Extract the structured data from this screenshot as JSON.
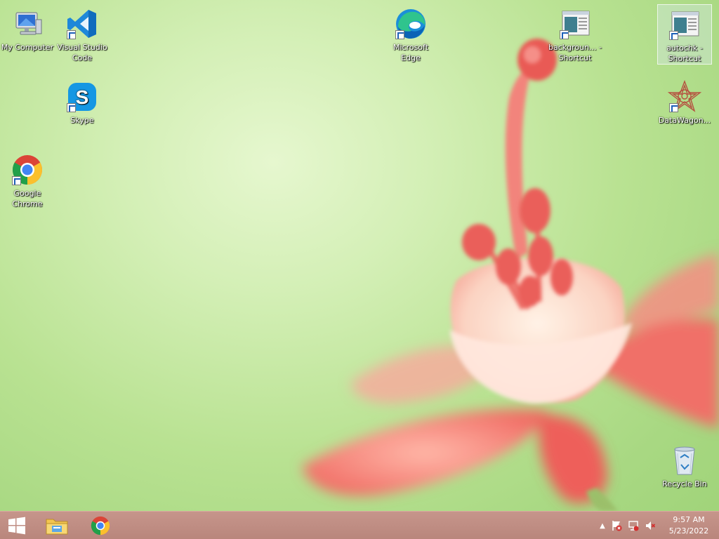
{
  "desktop": {
    "icons": [
      {
        "label": "My Computer",
        "icon": "computer-icon"
      },
      {
        "label": "Visual Studio Code",
        "icon": "vscode-icon"
      },
      {
        "label": "Skype",
        "icon": "skype-icon"
      },
      {
        "label": "Google Chrome",
        "icon": "chrome-icon"
      },
      {
        "label": "Microsoft Edge",
        "icon": "edge-icon"
      },
      {
        "label": "backgroun... - Shortcut",
        "icon": "window-shortcut-icon"
      },
      {
        "label": "autochk - Shortcut",
        "icon": "window-shortcut-icon"
      },
      {
        "label": "DataWagon...",
        "icon": "datawagon-icon"
      },
      {
        "label": "Recycle Bin",
        "icon": "recycle-bin-icon"
      }
    ]
  },
  "taskbar": {
    "start_icon": "windows-logo-icon",
    "pinned": [
      {
        "icon": "file-explorer-icon"
      },
      {
        "icon": "chrome-icon"
      }
    ],
    "tray_icons": [
      "show-hidden-icons-chevron",
      "action-center-flag-icon",
      "network-icon",
      "volume-muted-icon"
    ],
    "time": "9:57 AM",
    "date": "5/23/2022"
  },
  "colors": {
    "taskbar": "#bd8b81",
    "wallpaper_green": "#c6e9a6",
    "flower_pink": "#f07a74"
  }
}
